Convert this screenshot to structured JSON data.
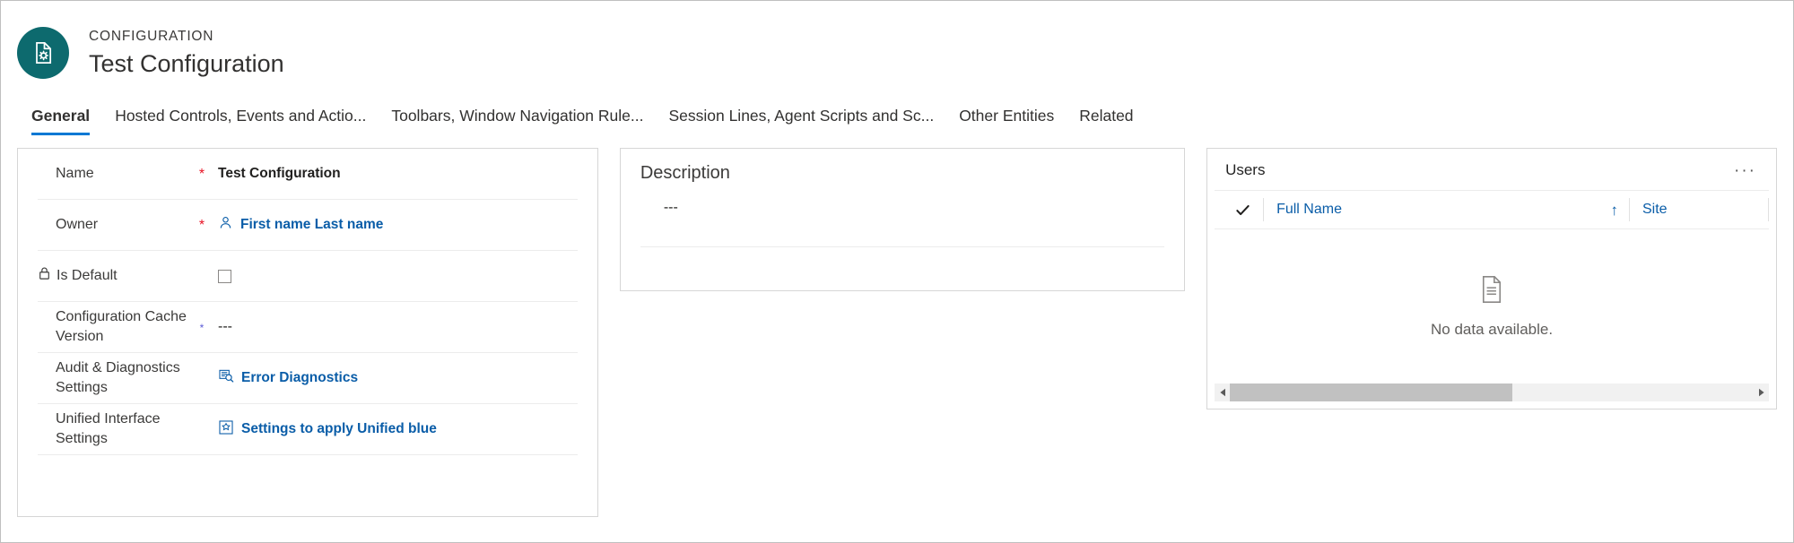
{
  "header": {
    "entity_type": "CONFIGURATION",
    "title": "Test Configuration",
    "icon": "document-gear-icon",
    "icon_bg": "#0d6a6e"
  },
  "tabs": [
    {
      "label": "General",
      "active": true
    },
    {
      "label": "Hosted Controls, Events and Actio...",
      "active": false
    },
    {
      "label": "Toolbars, Window Navigation Rule...",
      "active": false
    },
    {
      "label": "Session Lines, Agent Scripts and Sc...",
      "active": false
    },
    {
      "label": "Other Entities",
      "active": false
    },
    {
      "label": "Related",
      "active": false
    }
  ],
  "form": {
    "rows": [
      {
        "label": "Name",
        "required": "red",
        "value": "Test Configuration",
        "value_type": "strong",
        "icon": null
      },
      {
        "label": "Owner",
        "required": "red",
        "value": "First name Last name",
        "value_type": "link",
        "icon": "person-icon"
      },
      {
        "label": "Is Default",
        "required": "none",
        "value": "",
        "value_type": "checkbox",
        "checked": false,
        "label_icon": "lock-icon"
      },
      {
        "label": "Configuration Cache Version",
        "required": "blue",
        "value": "---",
        "value_type": "dash",
        "icon": null
      },
      {
        "label": "Audit & Diagnostics Settings",
        "required": "none",
        "value": "Error Diagnostics",
        "value_type": "link",
        "icon": "error-diagnostics-icon"
      },
      {
        "label": "Unified Interface Settings",
        "required": "none",
        "value": "Settings to apply Unified blue",
        "value_type": "link",
        "icon": "unified-interface-icon"
      }
    ]
  },
  "description": {
    "title": "Description",
    "value": "---"
  },
  "users": {
    "title": "Users",
    "menu_label": "···",
    "columns": [
      {
        "label": "Full Name",
        "sorted": true,
        "sort_direction": "↑"
      },
      {
        "label": "Site",
        "sorted": false,
        "sort_direction": ""
      }
    ],
    "select_all_icon": "checkmark-icon",
    "empty_icon": "document-icon",
    "empty_text": "No data available.",
    "scrollbar": {
      "left_arrow": "◀",
      "right_arrow": "▶",
      "thumb_percent": 54
    }
  },
  "colors": {
    "accent": "#0078d4",
    "link": "#0a5da8",
    "required_red": "#e81123",
    "required_blue": "#5b5bd6",
    "teal": "#0d6a6e"
  }
}
